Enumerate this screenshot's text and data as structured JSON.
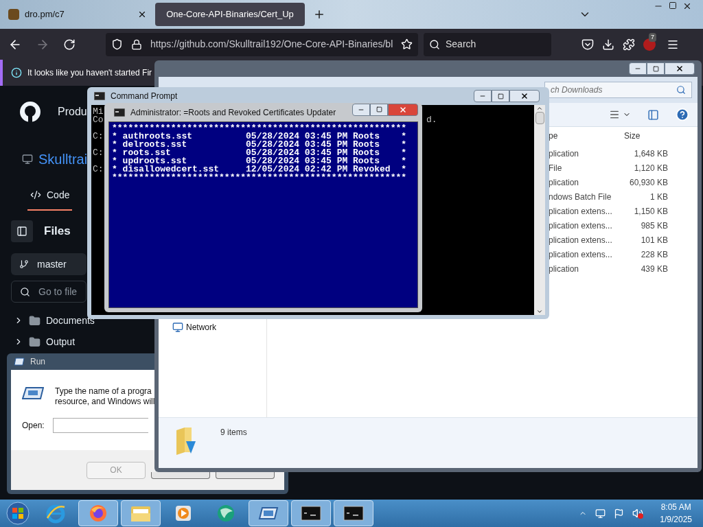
{
  "browser": {
    "tabs": [
      {
        "title": "dro.pm/c7",
        "selected": false
      },
      {
        "title": "One-Core-API-Binaries/Cert_Up",
        "selected": true
      }
    ],
    "url": "https://github.com/Skulltrail192/One-Core-API-Binaries/bl",
    "search": {
      "placeholder": "Search"
    },
    "extension_badge": "7",
    "notification": "It looks like you haven't started Fir"
  },
  "github": {
    "nav_text": "Produ",
    "repo": "Skulltrai",
    "tabs": [
      {
        "label": "Code",
        "selected": true
      }
    ],
    "files_title": "Files",
    "branch": "master",
    "go_to_file": {
      "placeholder": "Go to file"
    },
    "tree": [
      {
        "name": "Documents",
        "expanded": false
      },
      {
        "name": "Output",
        "expanded": false
      }
    ]
  },
  "explorer": {
    "search": {
      "placeholder": "ch Downloads"
    },
    "columns": [
      "pe",
      "Size"
    ],
    "rows": [
      {
        "type": "plication",
        "size": "1,648 KB"
      },
      {
        "type": "File",
        "size": "1,120 KB"
      },
      {
        "type": "plication",
        "size": "60,930 KB"
      },
      {
        "type": "ndows Batch File",
        "size": "1 KB"
      },
      {
        "type": "plication extens...",
        "size": "1,150 KB"
      },
      {
        "type": "plication extens...",
        "size": "985 KB"
      },
      {
        "type": "plication extens...",
        "size": "101 KB"
      },
      {
        "type": "plication extens...",
        "size": "228 KB"
      },
      {
        "type": "plication",
        "size": "439 KB"
      }
    ],
    "nav": [
      "Network"
    ],
    "status": "9 items"
  },
  "cmd": {
    "title": "Command Prompt",
    "left_lines": [
      "Mi",
      "Co",
      "C:",
      "C:",
      "C:"
    ],
    "right_text": "d."
  },
  "admin_cmd": {
    "title": "Administrator: =Roots and Revoked Certificates Updater",
    "lines": [
      "*******************************************************",
      "* authroots.sst          05/28/2024 03:45 PM Roots    *",
      "* delroots.sst           05/28/2024 03:45 PM Roots    *",
      "* roots.sst              05/28/2024 03:45 PM Roots    *",
      "* updroots.sst           05/28/2024 03:45 PM Roots    *",
      "* disallowedcert.sst     12/05/2024 02:42 PM Revoked  *",
      "*******************************************************"
    ]
  },
  "run": {
    "title": "Run",
    "description": [
      "Type the name of a progra",
      "resource, and Windows will"
    ],
    "open_label": "Open:",
    "ok": {
      "label": "OK",
      "disabled": true
    }
  },
  "taskbar": {
    "apps": [
      {
        "kind": "ie",
        "running": false
      },
      {
        "kind": "firefox",
        "running": true
      },
      {
        "kind": "folder",
        "running": true
      },
      {
        "kind": "media",
        "running": false
      },
      {
        "kind": "globe",
        "running": false
      },
      {
        "kind": "run",
        "running": true
      },
      {
        "kind": "cmd",
        "running": true
      },
      {
        "kind": "cmd",
        "running": true
      }
    ],
    "clock": {
      "time": "8:05 AM",
      "date": "1/9/2025"
    }
  }
}
